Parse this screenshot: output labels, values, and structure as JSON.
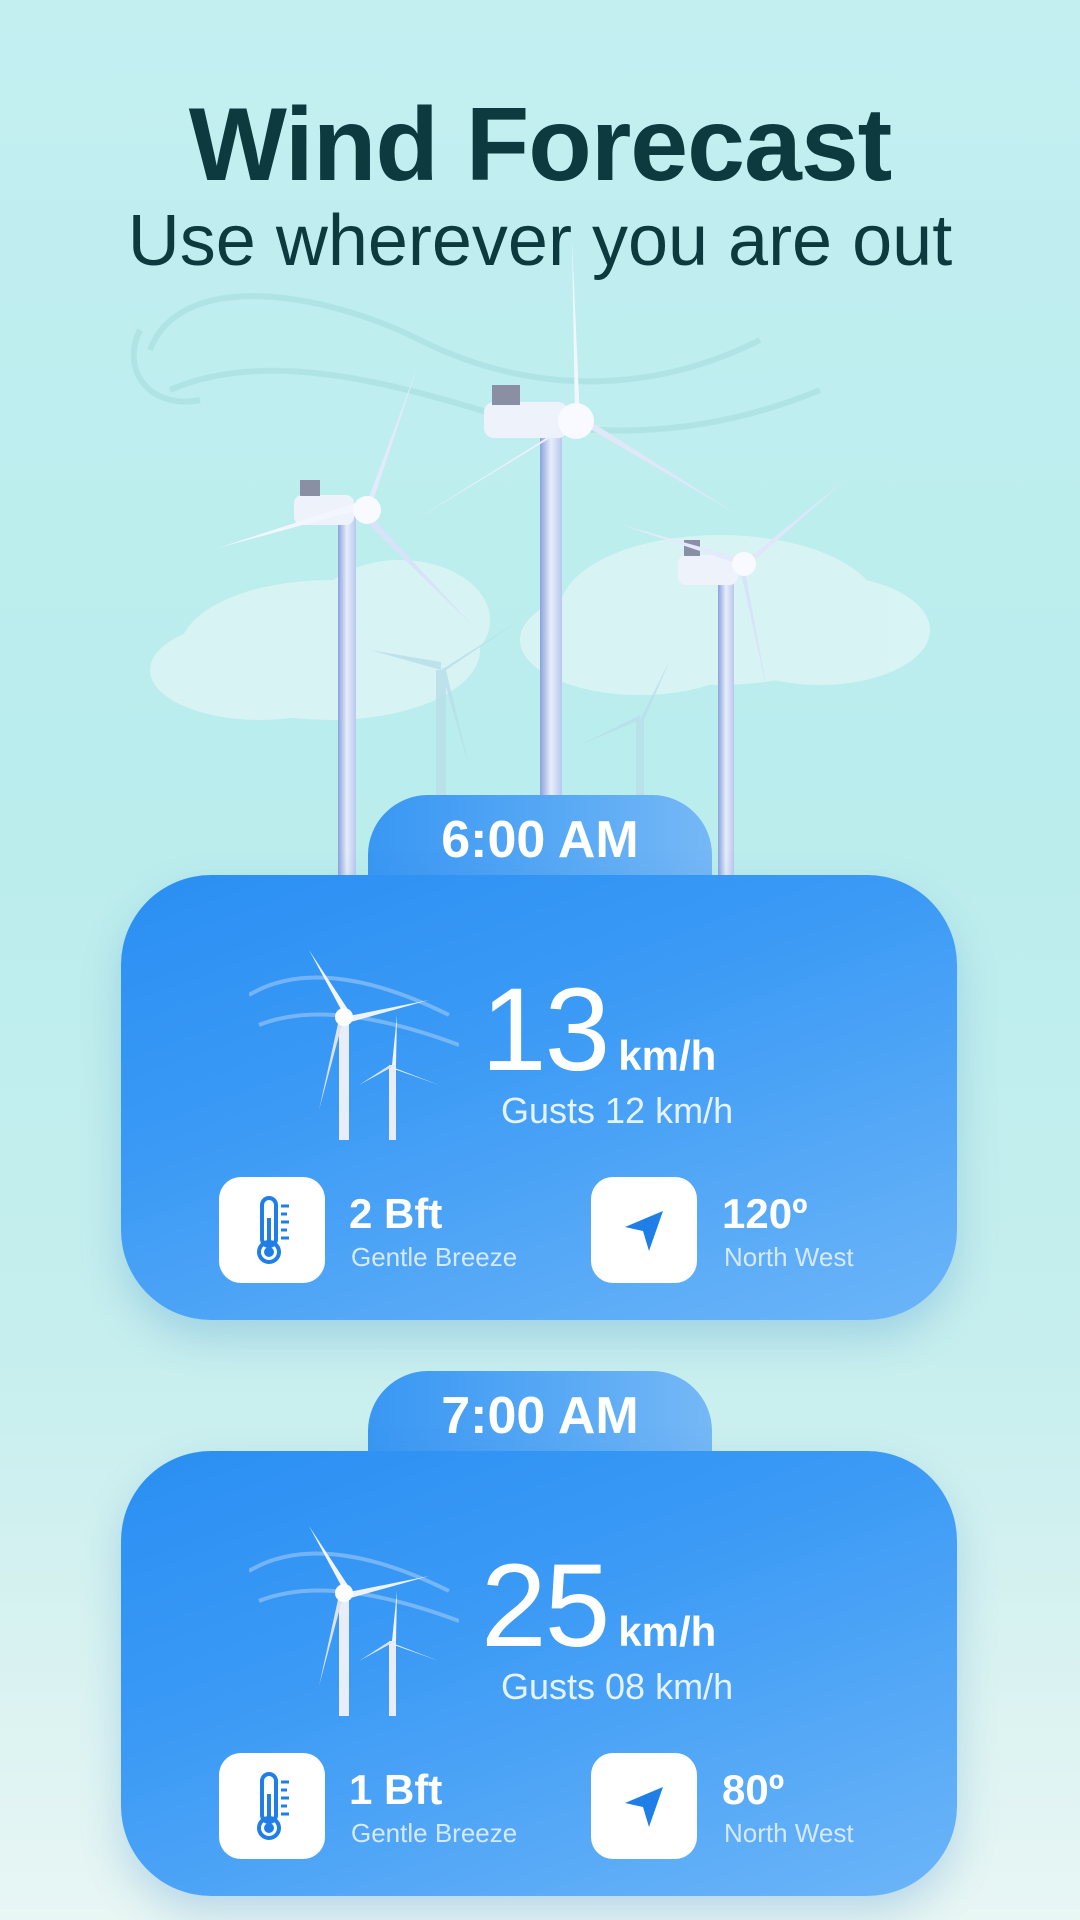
{
  "header": {
    "title": "Wind Forecast",
    "subtitle": "Use wherever you are out"
  },
  "forecasts": [
    {
      "time": "6:00 AM",
      "speed": "13",
      "unit": "km/h",
      "gusts": "Gusts 12 km/h",
      "beaufort": "2 Bft",
      "beaufort_label": "Gentle Breeze",
      "direction_deg": "120º",
      "direction_label": "North West"
    },
    {
      "time": "7:00 AM",
      "speed": "25",
      "unit": "km/h",
      "gusts": "Gusts 08 km/h",
      "beaufort": "1 Bft",
      "beaufort_label": "Gentle Breeze",
      "direction_deg": "80º",
      "direction_label": "North West"
    }
  ],
  "icons": {
    "hero": "wind-turbines-illustration",
    "card": "wind-turbine-icon",
    "beaufort": "thermometer-icon",
    "direction": "navigation-arrow-icon"
  },
  "colors": {
    "background": "#c3eff1",
    "title": "#0c3a3e",
    "card": "#2a8ff3",
    "accent": "#1f7fe6"
  }
}
